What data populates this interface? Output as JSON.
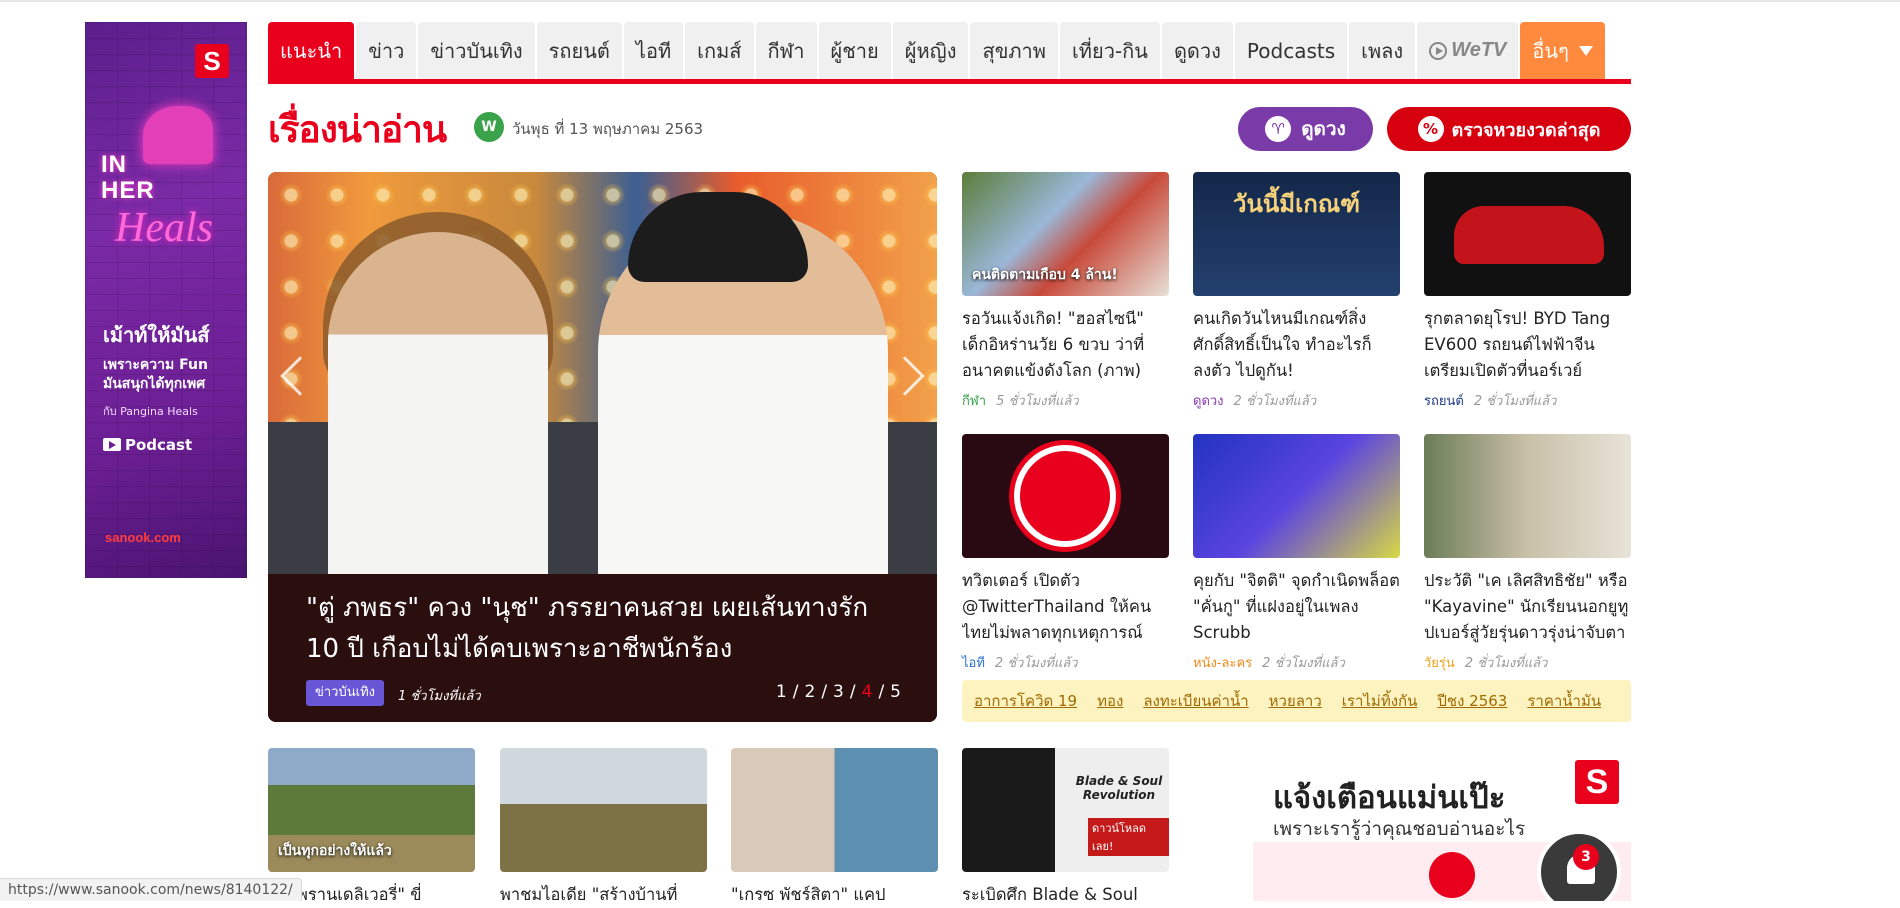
{
  "nav": {
    "tabs": [
      "แนะนำ",
      "ข่าว",
      "ข่าวบันเทิง",
      "รถยนต์",
      "ไอที",
      "เกมส์",
      "กีฬา",
      "ผู้ชาย",
      "ผู้หญิง",
      "สุขภาพ",
      "เที่ยว-กิน",
      "ดูดวง",
      "Podcasts",
      "เพลง"
    ],
    "wetv": "WeTV",
    "more": "อื่นๆ"
  },
  "header": {
    "title": "เรื่องน่าอ่าน",
    "weekday_badge": "W",
    "date": "วันพุธ ที่ 13 พฤษภาคม 2563",
    "horoscope_button": "ดูดวง",
    "lottery_button": "ตรวจหวยงวดล่าสุด",
    "horoscope_icon": "♈",
    "lottery_icon": "%"
  },
  "left_ad": {
    "logo": "S",
    "line1": "IN",
    "line2": "HER",
    "heals": "Heals",
    "tagline": "เม้าท์ให้มันส์",
    "text1": "เพราะความ Fun",
    "text2": "มันสนุกได้ทุกเพศ",
    "text3": "กับ Pangina Heals",
    "podcast": "Podcast",
    "brand": "sanook.com"
  },
  "hero": {
    "title": "\"ตู่ ภพธร\" ควง \"นุช\" ภรรยาคนสวย เผยเส้นทางรัก 10 ปี เกือบไม่ได้คบเพราะอาชีพนักร้อง",
    "category": "ข่าวบันเทิง",
    "time": "1 ชั่วโมงที่แล้ว",
    "pages": [
      "1",
      "2",
      "3",
      "4",
      "5"
    ],
    "current_page": "4"
  },
  "cards": [
    {
      "title": "รอวันแจ้งเกิด! \"ฮอสไซนี\" เด็กอิหร่านวัย 6 ขวบ ว่าที่อนาคตแข้งดังโลก (ภาพ)",
      "category": "กีฬา",
      "category_color": "#3aa24a",
      "time": "5 ชั่วโมงที่แล้ว",
      "overlay": "คนติดตามเกือบ 4 ล้าน!"
    },
    {
      "title": "คนเกิดวันไหนมีเกณฑ์สิ่งศักดิ์สิทธิ์เป็นใจ ทำอะไรก็ลงตัว ไปดูกัน!",
      "category": "ดูดวง",
      "category_color": "#8a3db0",
      "time": "2 ชั่วโมงที่แล้ว",
      "overlay": ""
    },
    {
      "title": "รุกตลาดยุโรป! BYD Tang EV600 รถยนต์ไฟฟ้าจีน เตรียมเปิดตัวที่นอร์เวย์",
      "category": "รถยนต์",
      "category_color": "#1e3a8a",
      "time": "2 ชั่วโมงที่แล้ว",
      "overlay": ""
    },
    {
      "title": "ทวิตเตอร์ เปิดตัว @TwitterThailand ให้คนไทยไม่พลาดทุกเหตุการณ์",
      "category": "ไอที",
      "category_color": "#2a6fd6",
      "time": "2 ชั่วโมงที่แล้ว",
      "overlay": ""
    },
    {
      "title": "คุยกับ \"จิตติ\" จุดกำเนิดพล็อต \"คั่นกู\" ที่แฝงอยู่ในเพลง Scrubb",
      "category": "หนัง-ละคร",
      "category_color": "#f08a1c",
      "time": "2 ชั่วโมงที่แล้ว",
      "overlay": ""
    },
    {
      "title": "ประวัติ \"เค เลิศสิทธิชัย\" หรือ \"Kayavine\" นักเรียนนอกยูทูปเบอร์สู่วัยรุ่นดาวรุ่งน่าจับตา",
      "category": "วัยรุ่น",
      "category_color": "#f0a21c",
      "time": "2 ชั่วโมงที่แล้ว",
      "overlay": ""
    }
  ],
  "tags": [
    "อาการโควิด 19",
    "ทอง",
    "ลงทะเบียนค่าน้ำ",
    "หวยลาว",
    "เราไม่ทิ้งกัน",
    "ปีชง 2563",
    "ราคาน้ำมัน"
  ],
  "bottom_cards": [
    {
      "title": "หารพรานเดลิเวอรี่\" ขี่",
      "overlay": "เป็นทุกอย่างให้แล้ว"
    },
    {
      "title": "พาชมไอเดีย \"สร้างบ้านที่",
      "overlay": ""
    },
    {
      "title": "\"เกรซ พัชร์สิตา\" แคป",
      "overlay": ""
    },
    {
      "title": "ระเบิดศึก Blade & Soul",
      "overlay": "Blade & Soul Revolution",
      "overlay2": "ดาวน์โหลดเลย!"
    }
  ],
  "notify_ad": {
    "headline": "แจ้งเตือนแม่นเป๊ะ",
    "sub": "เพราะเรารู้ว่าคุณชอบอ่านอะไร",
    "logo": "S",
    "badge": "3"
  },
  "status_url": "https://www.sanook.com/news/8140122/"
}
